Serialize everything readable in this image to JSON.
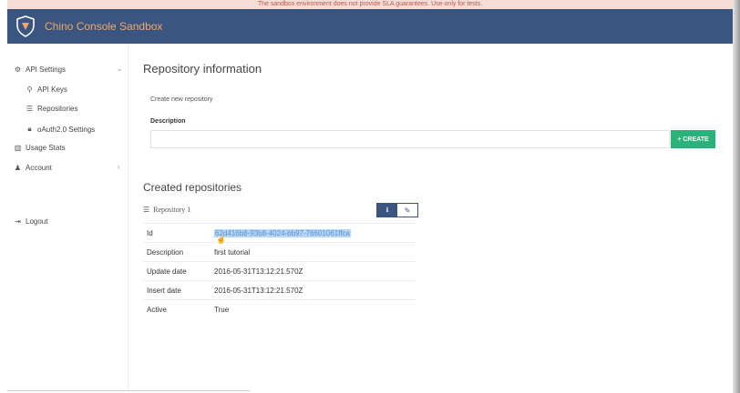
{
  "banner": {
    "text": "The sandbox environment does not provide SLA guarantees. Use only for tests."
  },
  "app": {
    "title": "Chino Console Sandbox",
    "accent": "#f0a86a",
    "header_bg": "#3a5580"
  },
  "sidebar": {
    "items": [
      {
        "label": "API Settings",
        "icon": "gears-icon"
      },
      {
        "label": "API Keys",
        "icon": "key-icon"
      },
      {
        "label": "Repositories",
        "icon": "database-icon"
      },
      {
        "label": "oAuth2.0 Settings",
        "icon": "lock-icon"
      },
      {
        "label": "Usage Stats",
        "icon": "bar-chart-icon"
      },
      {
        "label": "Account",
        "icon": "user-icon"
      },
      {
        "label": "Logout",
        "icon": "sign-out-icon"
      }
    ]
  },
  "main": {
    "title": "Repository information",
    "create_label": "Create new repository",
    "description_label": "Description",
    "description_value": "",
    "create_button": "+ CREATE",
    "created_title": "Created repositories"
  },
  "repository": {
    "name": "Repository 1",
    "fields": [
      {
        "key": "Id",
        "value": "62d416b8-93b8-4024-bb97-76601061ffca"
      },
      {
        "key": "Description",
        "value": "first tutorial"
      },
      {
        "key": "Update date",
        "value": "2016-05-31T13:12:21.570Z"
      },
      {
        "key": "Insert date",
        "value": "2016-05-31T13:12:21.570Z"
      },
      {
        "key": "Active",
        "value": "True"
      }
    ]
  },
  "colors": {
    "create_button": "#2ab27b",
    "selection": "#b7d6f5"
  }
}
